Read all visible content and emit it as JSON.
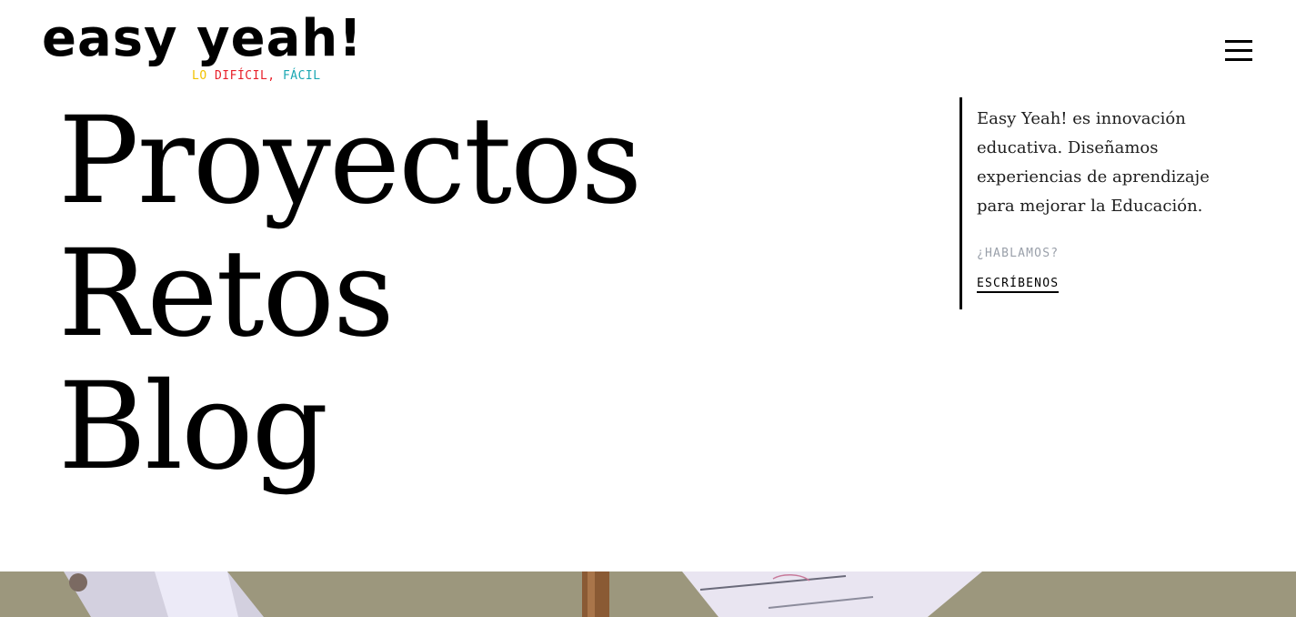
{
  "brand": {
    "name": "easy yeah!",
    "tagline_parts": [
      "LO ",
      "DIFÍCIL, ",
      "FÁCIL"
    ],
    "colors": {
      "yellow": "#f2c200",
      "red": "#e8202a",
      "teal": "#1aa7b3"
    }
  },
  "header": {
    "menu_icon": "hamburger-menu-icon"
  },
  "hero_nav": {
    "items": [
      {
        "label": "Proyectos"
      },
      {
        "label": "Retos"
      },
      {
        "label": "Blog"
      }
    ]
  },
  "intro": {
    "text": "Easy Yeah! es innovación educativa. Diseñamos experiencias de aprendizaje para mejorar la Educación.",
    "question": "¿HABLAMOS?",
    "cta": "ESCRÍBENOS"
  }
}
